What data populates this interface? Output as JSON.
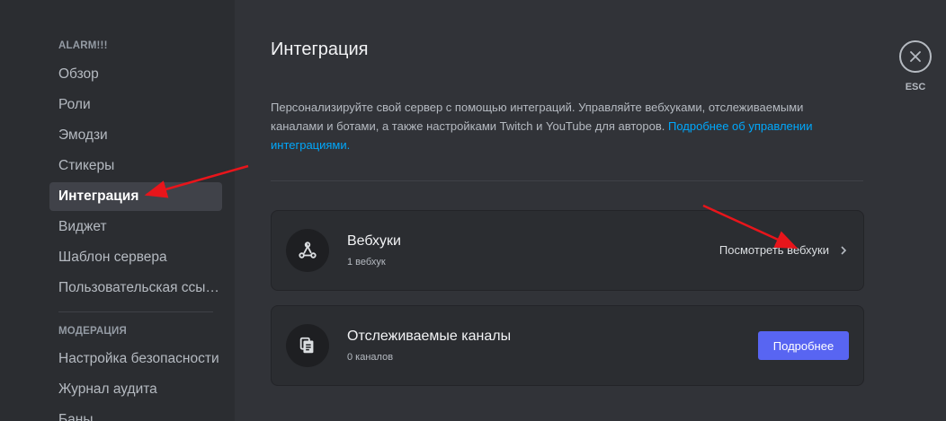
{
  "sidebar": {
    "server_header": "ALARM!!!",
    "items": [
      {
        "label": "Обзор"
      },
      {
        "label": "Роли"
      },
      {
        "label": "Эмодзи"
      },
      {
        "label": "Стикеры"
      },
      {
        "label": "Интеграция"
      },
      {
        "label": "Виджет"
      },
      {
        "label": "Шаблон сервера"
      },
      {
        "label": "Пользовательская ссылка"
      }
    ],
    "moderation_header": "МОДЕРАЦИЯ",
    "moderation_items": [
      {
        "label": "Настройка безопасности"
      },
      {
        "label": "Журнал аудита"
      },
      {
        "label": "Баны"
      }
    ]
  },
  "main": {
    "title": "Интеграция",
    "description": "Персонализируйте свой сервер с помощью интеграций. Управляйте вебхуками, отслеживаемыми каналами и ботами, а также настройками Twitch и YouTube для авторов.",
    "learn_more_link": "Подробнее об управлении интеграциями.",
    "cards": [
      {
        "title": "Вебхуки",
        "subtitle": "1 вебхук",
        "action_label": "Посмотреть вебхуки",
        "icon": "webhook-icon"
      },
      {
        "title": "Отслеживаемые каналы",
        "subtitle": "0 каналов",
        "action_label": "Подробнее",
        "icon": "channel-follow-icon"
      }
    ]
  },
  "close": {
    "label": "ESC",
    "icon": "close-icon"
  },
  "colors": {
    "accent": "#5865f2",
    "link": "#00a8fc",
    "annotation": "#e8151b"
  }
}
